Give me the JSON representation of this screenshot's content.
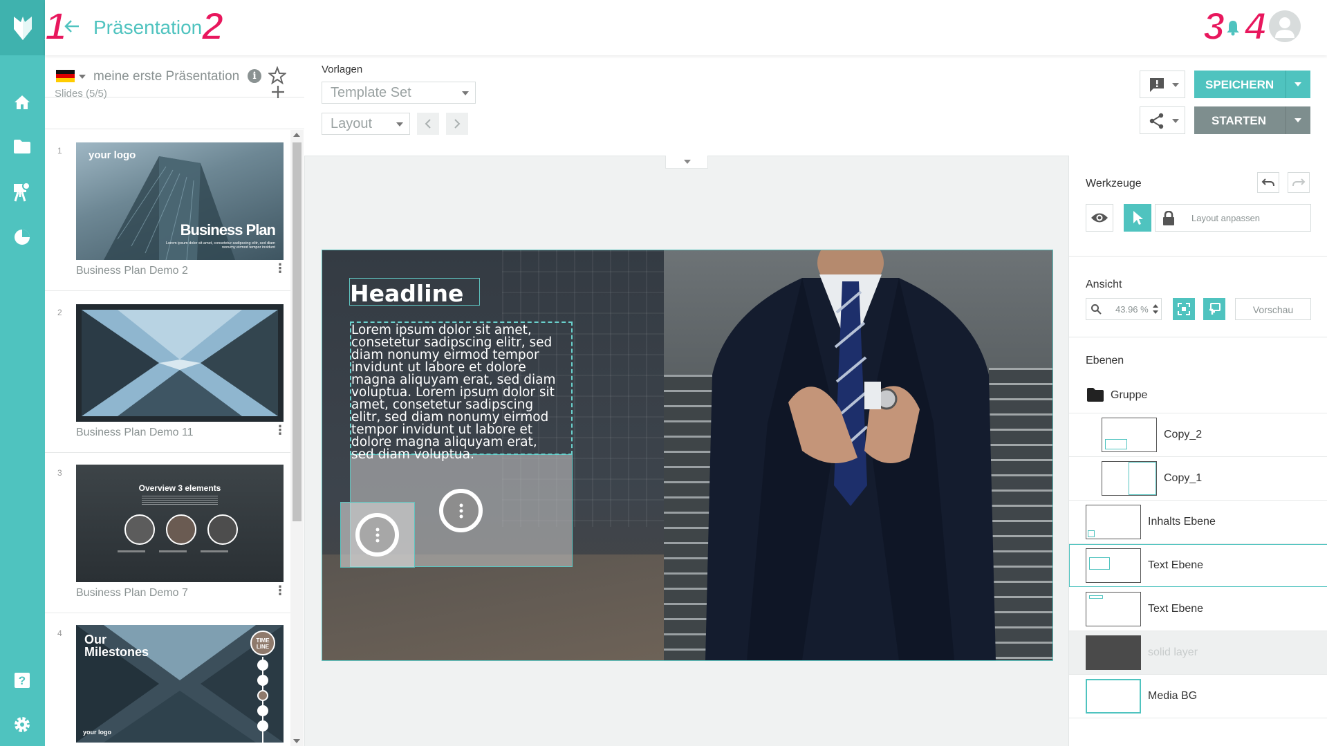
{
  "header": {
    "title": "Präsentation",
    "markers": [
      "1",
      "2",
      "3",
      "4"
    ]
  },
  "slides_panel": {
    "flag": "de",
    "presentation_name": "meine erste Präsentation",
    "slides_count": "Slides (5/5)",
    "items": [
      {
        "num": "1",
        "label": "Business Plan Demo 2",
        "thumb_logo": "your logo",
        "thumb_title": "Business Plan",
        "thumb_caption": "Lorem ipsum dolor sit amet, consetetur sadipscing elitr, sed diam nonumy eirmod tempor invidunt"
      },
      {
        "num": "2",
        "label": "Business Plan Demo 11"
      },
      {
        "num": "3",
        "label": "Business Plan Demo 7",
        "thumb_title": "Overview 3 elements"
      },
      {
        "num": "4",
        "label": "",
        "thumb_title_line1": "Our",
        "thumb_title_line2": "Milestones",
        "thumb_badge_line1": "TIME",
        "thumb_badge_line2": "LINE",
        "thumb_logo": "your logo"
      }
    ]
  },
  "toolbar": {
    "vorlagen_label": "Vorlagen",
    "template_set": "Template Set",
    "layout": "Layout",
    "save_label": "SPEICHERN",
    "start_label": "STARTEN"
  },
  "slide": {
    "headline": "Headline",
    "body_text": "Lorem ipsum dolor sit amet, consetetur sadipscing elitr, sed diam nonumy eirmod tempor invidunt ut labore et dolore magna aliquyam erat, sed diam voluptua. Lorem ipsum dolor sit amet, consetetur sadipscing elitr, sed diam nonumy eirmod tempor invidunt ut labore et dolore magna aliquyam erat, sed diam voluptua."
  },
  "right_panel": {
    "tools_title": "Werkzeuge",
    "layout_adjust": "Layout anpassen",
    "view_title": "Ansicht",
    "zoom_value": "43.96 %",
    "preview_label": "Vorschau",
    "layers_title": "Ebenen",
    "group_label": "Gruppe",
    "layers": [
      {
        "name": "Copy_2"
      },
      {
        "name": "Copy_1"
      },
      {
        "name": "Inhalts Ebene"
      },
      {
        "name": "Text Ebene"
      },
      {
        "name": "Text Ebene"
      },
      {
        "name": "solid layer"
      },
      {
        "name": "Media BG"
      }
    ]
  },
  "colors": {
    "accent": "#4fc3bf",
    "marker": "#e8175d",
    "grey_button": "#7e8e8e"
  },
  "icons": [
    "logo-icon",
    "back-arrow-icon",
    "bell-icon",
    "avatar-icon",
    "home-icon",
    "folder-icon",
    "presenter-icon",
    "pie-chart-icon",
    "help-icon",
    "gear-icon",
    "info-icon",
    "star-icon",
    "plus-icon",
    "feedback-icon",
    "share-icon",
    "undo-icon",
    "redo-icon",
    "eye-icon",
    "pointer-icon",
    "lock-icon",
    "search-icon",
    "fit-screen-icon",
    "touch-icon",
    "folder-icon"
  ]
}
